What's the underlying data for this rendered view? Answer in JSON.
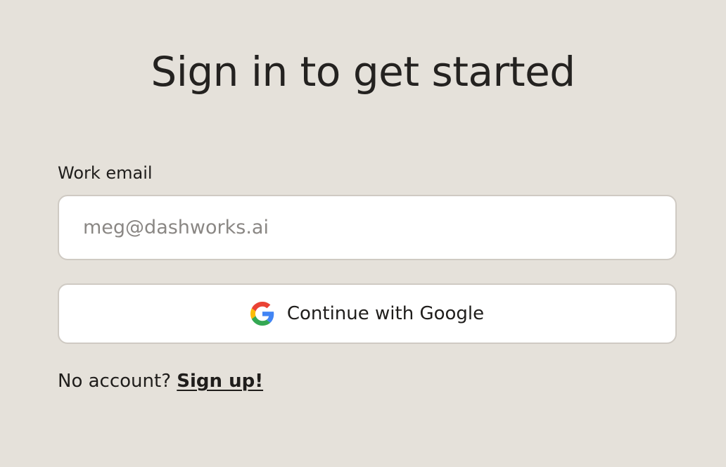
{
  "heading": "Sign in to get started",
  "form": {
    "email_label": "Work email",
    "email_placeholder": "meg@dashworks.ai",
    "email_value": "",
    "google_button_label": "Continue with Google",
    "google_icon": "google-g-icon"
  },
  "footer": {
    "prompt": "No account?",
    "signup_link": "Sign up!"
  },
  "colors": {
    "background": "#e5e1da",
    "text": "#1f1d1b",
    "input_border": "#cfcac3",
    "placeholder": "#8a8784"
  }
}
